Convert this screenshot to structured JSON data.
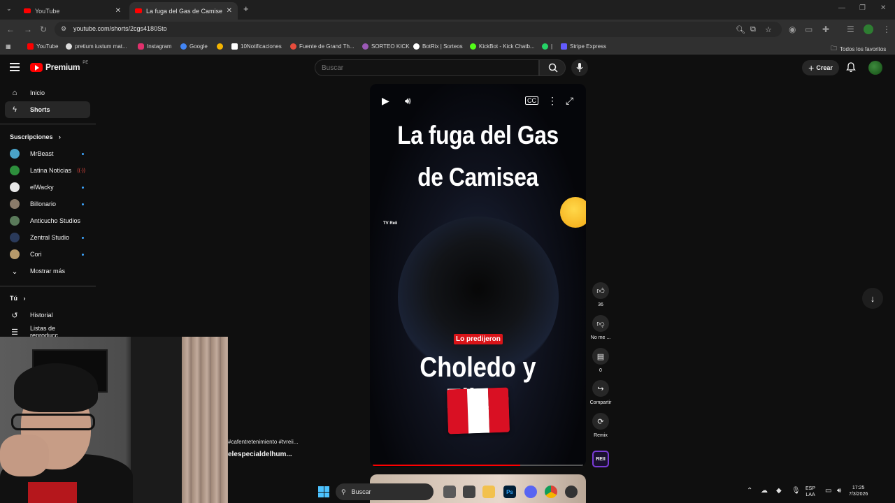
{
  "browser": {
    "tabs": [
      {
        "title": "YouTube",
        "active": false
      },
      {
        "title": "La fuga del Gas de Camisea #el",
        "active": true
      }
    ],
    "new_tab": "+",
    "url": "youtube.com/shorts/2cgs4180Sto",
    "bookmarks": [
      {
        "label": "YouTube",
        "color": "#ff0000"
      },
      {
        "label": "pretium iustum mat...",
        "color": "#dddddd"
      },
      {
        "label": "Instagram",
        "color": "#e1306c"
      },
      {
        "label": "Google",
        "color": "#4285f4"
      },
      {
        "label": "",
        "color": "#f4b400"
      },
      {
        "label": "10Notificaciones",
        "color": "#ffffff"
      },
      {
        "label": "Fuente de Grand Th...",
        "color": "#e74c3c"
      },
      {
        "label": "SORTEO KICK",
        "color": "#9b59b6"
      },
      {
        "label": "BotRix | Sorteos",
        "color": "#ffffff"
      },
      {
        "label": "KickBot - Kick Chatb...",
        "color": "#53fc18"
      },
      {
        "label": "|",
        "color": "#25d366"
      },
      {
        "label": "Stripe Express",
        "color": "#635bff"
      }
    ],
    "all_bookmarks": "Todos los favoritos"
  },
  "yt": {
    "logo": "Premium",
    "country": "PE",
    "search_placeholder": "Buscar",
    "create": "Crear"
  },
  "sidebar": {
    "home": "Inicio",
    "shorts": "Shorts",
    "subs_heading": "Suscripciones",
    "subs": [
      {
        "name": "MrBeast",
        "color": "#4aa3c8",
        "live": false
      },
      {
        "name": "Latina Noticias",
        "color": "#2d8f3c",
        "live": true
      },
      {
        "name": "elWacky",
        "color": "#e8e8e8",
        "live": false
      },
      {
        "name": "Billonario",
        "color": "#8a7b6a",
        "live": false
      },
      {
        "name": "Anticucho Studios",
        "color": "#5a7a5a",
        "live": false
      },
      {
        "name": "Zentral Studio",
        "color": "#2a3a5a",
        "live": false
      },
      {
        "name": "Cori",
        "color": "#b79a6a",
        "live": false
      }
    ],
    "show_more": "Mostrar más",
    "you_heading": "Tú",
    "history": "Historial",
    "playlists": "Listas de reproducc..."
  },
  "short": {
    "title_top": "La fuga del Gas de Camisea",
    "watermark": "TV Reii",
    "badge": "Lo predijeron",
    "title_bottom": "Choledo y Eliam",
    "progress": 0.7,
    "hashtags": "#cafentretenimiento #tvreii...",
    "channel_line": "elespecialdelhum..."
  },
  "actions": {
    "likes": "36",
    "dislike": "No me ...",
    "comments": "0",
    "share": "Compartir",
    "remix": "Remix",
    "channel": "REII"
  },
  "taskbar": {
    "search": "Buscar",
    "lang1": "ESP",
    "lang2": "LAA",
    "time": "17:25",
    "date": "7/3/2026"
  }
}
